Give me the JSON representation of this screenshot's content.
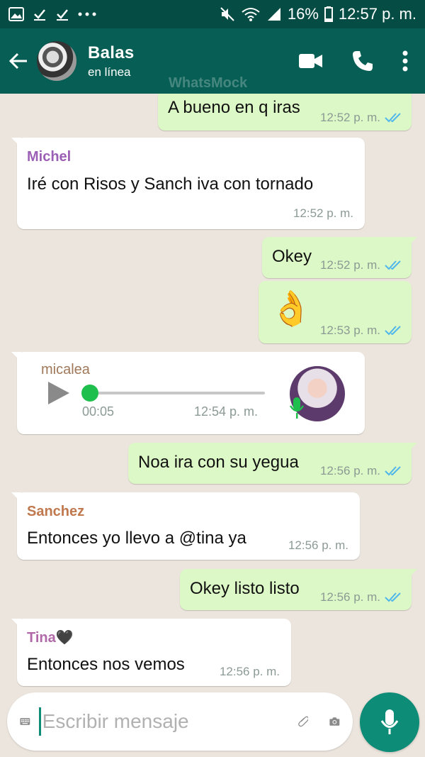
{
  "status_bar": {
    "battery": "16%",
    "time": "12:57 p. m."
  },
  "header": {
    "contact_name": "Balas",
    "contact_status": "en línea",
    "watermark": "WhatsMock"
  },
  "messages": [
    {
      "type": "out",
      "text": "A bueno en q iras",
      "time": "12:52 p. m."
    },
    {
      "type": "in",
      "sender": "Michel",
      "sender_color": "#9c5fb6",
      "text": "Iré con  Risos y  Sanch iva con tornado",
      "time": "12:52 p. m."
    },
    {
      "type": "out",
      "text": "Okey",
      "time": "12:52 p. m."
    },
    {
      "type": "out",
      "emoji": "👌",
      "time": "12:53 p. m."
    },
    {
      "type": "voice",
      "sender": "micalea",
      "sender_color": "#a0785a",
      "duration": "00:05",
      "progress": 0.0,
      "time": "12:54 p. m."
    },
    {
      "type": "out",
      "text": "Noa ira con su yegua",
      "time": "12:56 p. m."
    },
    {
      "type": "in",
      "sender": "Sanchez",
      "sender_color": "#c0784e",
      "text": "Entonces yo llevo a  @tina ya",
      "time": "12:56 p. m."
    },
    {
      "type": "out",
      "text": "Okey listo listo",
      "time": "12:56 p. m."
    },
    {
      "type": "in",
      "sender": "Tina🖤",
      "sender_color": "#b068a8",
      "text": "Entonces nos vemos",
      "time": "12:56 p. m."
    }
  ],
  "input": {
    "placeholder": "Escribir mensaje"
  },
  "colors": {
    "header": "#075e54",
    "status_bar": "#054d44",
    "outgoing_bubble": "#dcf8c6",
    "incoming_bubble": "#ffffff",
    "accent": "#0d8c77",
    "read_ticks": "#4fb6ec"
  }
}
